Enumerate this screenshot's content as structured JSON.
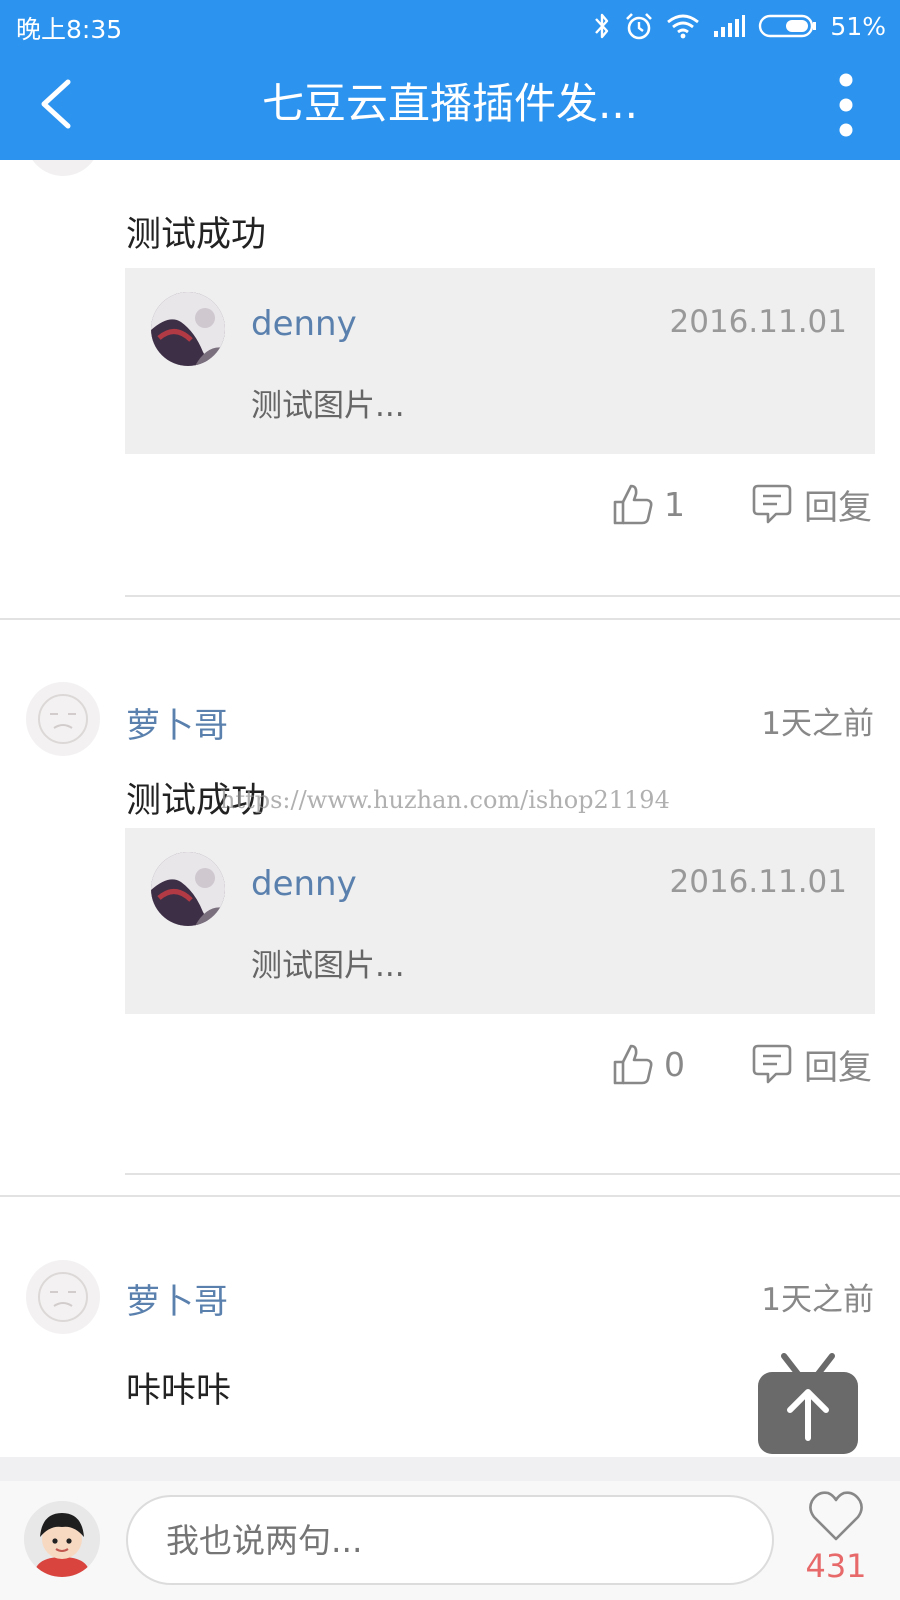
{
  "status": {
    "time": "晚上8:35",
    "battery": "51%"
  },
  "header": {
    "title": "七豆云直播插件发..."
  },
  "post1": {
    "text": "测试成功",
    "quote": {
      "name": "denny",
      "date": "2016.11.01",
      "text": "测试图片..."
    },
    "likes": "1",
    "reply_label": "回复"
  },
  "post2": {
    "author": "萝卜哥",
    "time": "1天之前",
    "text": "测试成功",
    "quote": {
      "name": "denny",
      "date": "2016.11.01",
      "text": "测试图片..."
    },
    "likes": "0",
    "reply_label": "回复"
  },
  "post3": {
    "author": "萝卜哥",
    "time": "1天之前",
    "text": "咔咔咔"
  },
  "watermark": "https://www.huzhan.com/ishop21194",
  "bottom": {
    "placeholder": "我也说两句...",
    "favorites": "431"
  },
  "colors": {
    "brand": "#2c93ee",
    "link": "#5a80ae",
    "heart": "#e7696a"
  },
  "icons": [
    "back-icon",
    "more-icon",
    "bluetooth-icon",
    "alarm-icon",
    "wifi-icon",
    "signal-icon",
    "battery-icon",
    "thumbs-up-icon",
    "comment-icon",
    "arrow-up-icon",
    "heart-icon"
  ]
}
